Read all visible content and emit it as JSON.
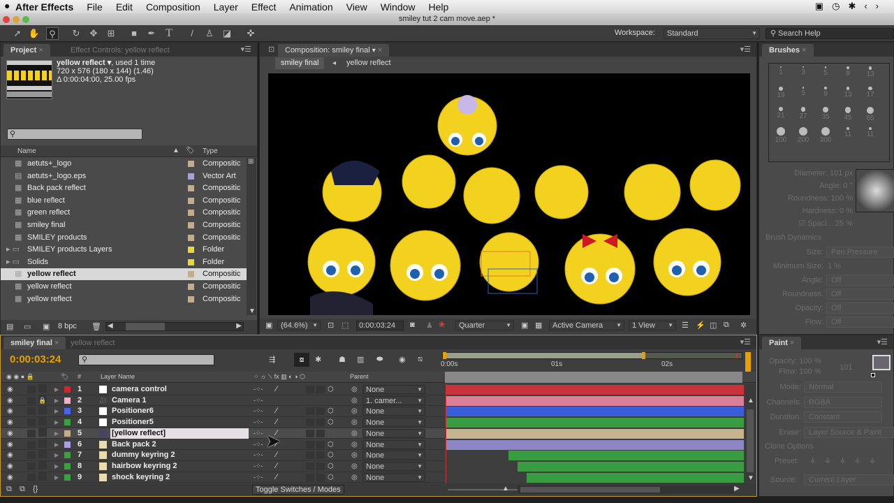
{
  "menubar": {
    "app": "After Effects",
    "items": [
      "File",
      "Edit",
      "Composition",
      "Layer",
      "Effect",
      "Animation",
      "View",
      "Window",
      "Help"
    ]
  },
  "window": {
    "title": "smiley tut 2 cam move.aep *"
  },
  "toolbar": {
    "workspace_label": "Workspace:",
    "workspace_value": "Standard",
    "search_placeholder": "Search Help"
  },
  "project": {
    "tab": "Project",
    "tab_effect_controls": "Effect Controls: yellow reflect",
    "selected_name": "yellow reflect ▾",
    "used": ", used 1 time",
    "dims": "720 x 576  (180 x 144) (1.46)",
    "duration": "Δ 0:00:04:00, 25.00 fps",
    "col_name": "Name",
    "col_type": "Type",
    "bpc": "8 bpc",
    "items": [
      {
        "name": "aetuts+_logo",
        "type": "Compositic",
        "color": "#c4ad8a",
        "icon": "comp"
      },
      {
        "name": "aetuts+_logo.eps",
        "type": "Vector Art",
        "color": "#a8a0d8",
        "icon": "file"
      },
      {
        "name": "Back pack reflect",
        "type": "Compositic",
        "color": "#c4ad8a",
        "icon": "comp"
      },
      {
        "name": "blue reflect",
        "type": "Compositic",
        "color": "#c4ad8a",
        "icon": "comp"
      },
      {
        "name": "green reflect",
        "type": "Compositic",
        "color": "#c4ad8a",
        "icon": "comp"
      },
      {
        "name": "smiley final",
        "type": "Compositic",
        "color": "#c4ad8a",
        "icon": "comp"
      },
      {
        "name": "SMILEY products",
        "type": "Compositic",
        "color": "#c4ad8a",
        "icon": "comp"
      },
      {
        "name": "SMILEY products Layers",
        "type": "Folder",
        "color": "#e8d830",
        "icon": "folder"
      },
      {
        "name": "Solids",
        "type": "Folder",
        "color": "#e8d830",
        "icon": "folder"
      },
      {
        "name": "yellow reflect",
        "type": "Compositic",
        "color": "#c4ad8a",
        "icon": "comp",
        "selected": true
      },
      {
        "name": "yellow reflect",
        "type": "Compositic",
        "color": "#c4ad8a",
        "icon": "comp"
      },
      {
        "name": "yellow reflect",
        "type": "Compositic",
        "color": "#c4ad8a",
        "icon": "comp"
      }
    ]
  },
  "composition": {
    "tab": "Composition: smiley final",
    "breadcrumbs": [
      "smiley final",
      "yellow reflect"
    ],
    "zoom": "(64.6%)",
    "timecode": "0:00:03:24",
    "resolution": "Quarter",
    "camera": "Active Camera",
    "views": "1 View"
  },
  "brushes": {
    "tab": "Brushes",
    "sizes": [
      "1",
      "3",
      "5",
      "9",
      "13",
      "19",
      "5",
      "9",
      "13",
      "17",
      "21",
      "27",
      "35",
      "45",
      "65",
      "100",
      "200",
      "300",
      "11",
      "11"
    ],
    "diameter": "Diameter: 101 px",
    "angle": "Angle: 0 °",
    "roundness": "Roundness: 100 %",
    "hardness": "Hardness: 0 %",
    "spacing": "Spaci...  25 %",
    "dynamics": "Brush Dynamics",
    "fields": [
      {
        "label": "Size:",
        "value": "Pen Pressure"
      },
      {
        "label": "Minimum Size:",
        "value": "1 %"
      },
      {
        "label": "Angle:",
        "value": "Off"
      },
      {
        "label": "Roundness:",
        "value": "Off"
      },
      {
        "label": "Opacity:",
        "value": "Off"
      },
      {
        "label": "Flow:",
        "value": "Off"
      }
    ]
  },
  "paint": {
    "tab": "Paint",
    "opacity": "Opacity: 100 %",
    "flow": "Flow: 100 %",
    "brush_size": "101",
    "fields": [
      {
        "label": "Mode:",
        "value": "Normal"
      },
      {
        "label": "Channels:",
        "value": "RGBA"
      },
      {
        "label": "Duration:",
        "value": "Constant"
      },
      {
        "label": "Erase:",
        "value": "Layer Source & Paint"
      }
    ],
    "clone_options": "Clone Options",
    "preset": "Preset:",
    "source_label": "Source:",
    "source_value": "Current Layer"
  },
  "timeline": {
    "tabs": [
      "smiley final",
      "yellow reflect"
    ],
    "timecode": "0:00:03:24",
    "col_hash": "#",
    "col_layer_name": "Layer Name",
    "col_parent": "Parent",
    "ruler": [
      "0:00s",
      "01s",
      "02s"
    ],
    "toggle": "Toggle Switches / Modes",
    "layers": [
      {
        "num": "1",
        "name": "camera control",
        "color": "#d02828",
        "parent": "None",
        "bar": "#c8323a",
        "start": 0,
        "icon": "solid"
      },
      {
        "num": "2",
        "name": "Camera 1",
        "color": "#f0b0c8",
        "parent": "1. camer...",
        "bar": "#d98096",
        "start": 0,
        "icon": "camera",
        "locked": true
      },
      {
        "num": "3",
        "name": "Positioner6",
        "color": "#4a64e8",
        "parent": "None",
        "bar": "#3a5ed8",
        "start": 0,
        "icon": "solid"
      },
      {
        "num": "4",
        "name": "Positioner5",
        "color": "#3aa040",
        "parent": "None",
        "bar": "#3a9c40",
        "start": 0,
        "icon": "solid"
      },
      {
        "num": "5",
        "name": "[yellow reflect]",
        "color": "#c4ad8a",
        "parent": "None",
        "bar": "#c4b48e",
        "start": 0,
        "icon": "comp",
        "selected": true
      },
      {
        "num": "6",
        "name": "Back pack 2",
        "color": "#a8a0e0",
        "parent": "None",
        "bar": "#8c86c4",
        "start": 0,
        "icon": "footage"
      },
      {
        "num": "7",
        "name": "dummy keyring 2",
        "color": "#3aa040",
        "parent": "None",
        "bar": "#3a9c40",
        "start": 0.21,
        "icon": "footage"
      },
      {
        "num": "8",
        "name": "hairbow keyring 2",
        "color": "#3aa040",
        "parent": "None",
        "bar": "#3a9c40",
        "start": 0.24,
        "icon": "footage"
      },
      {
        "num": "9",
        "name": "shock keyring 2",
        "color": "#3aa040",
        "parent": "None",
        "bar": "#3a9c40",
        "start": 0.27,
        "icon": "footage"
      }
    ]
  },
  "colors": {
    "accent": "#e8a000",
    "panel": "#4a4a4a"
  }
}
